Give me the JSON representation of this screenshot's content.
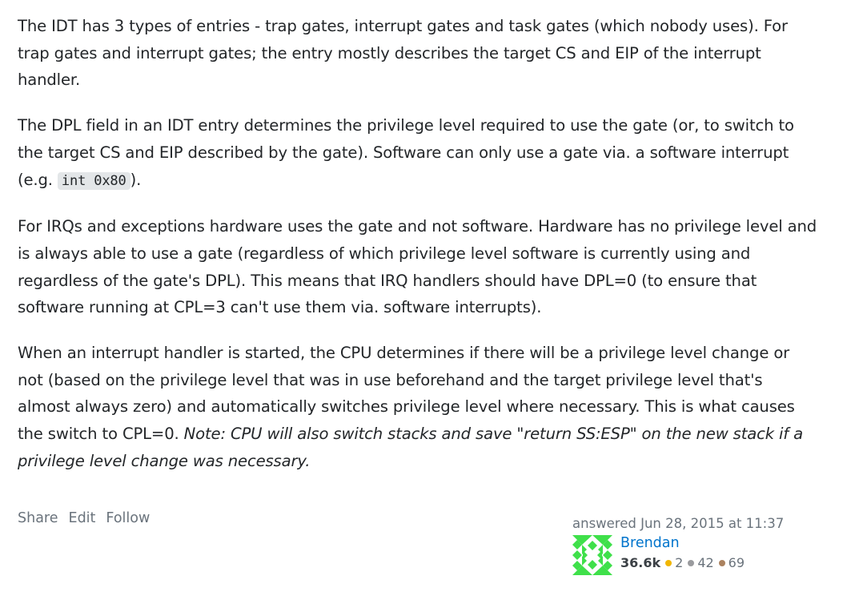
{
  "answer": {
    "p1": "The IDT has 3 types of entries - trap gates, interrupt gates and task gates (which nobody uses). For trap gates and interrupt gates; the entry mostly describes the target CS and EIP of the interrupt handler.",
    "p2_text": "The DPL field in an IDT entry determines the privilege level required to use the gate (or, to switch to the target CS and EIP described by the gate). Software can only use a gate via. a software interrupt (e.g. ",
    "p2_code": "int 0x80",
    "p2_end": ").",
    "p3": "For IRQs and exceptions hardware uses the gate and not software. Hardware has no privilege level and is always able to use a gate (regardless of which privilege level software is currently using and regardless of the gate's DPL). This means that IRQ handlers should have DPL=0 (to ensure that software running at CPL=3 can't use them via. software interrupts).",
    "p4_text": "When an interrupt handler is started, the CPU determines if there will be a privilege level change or not (based on the privilege level that was in use beforehand and the target privilege level that's almost always zero) and automatically switches privilege level where necessary. This is what causes the switch to CPL=0. ",
    "p4_italic": "Note: CPU will also switch stacks and save \"return SS:ESP\" on the new stack if a privilege level change was necessary."
  },
  "menu": {
    "share": "Share",
    "edit": "Edit",
    "follow": "Follow"
  },
  "signature": {
    "answered": "answered Jun 28, 2015 at 11:37",
    "user_name": "Brendan",
    "reputation": "36.6k",
    "gold_count": "2",
    "silver_count": "42",
    "bronze_count": "69"
  },
  "colors": {
    "link": "#0074cc",
    "muted": "#6a737c",
    "gold": "#f1b600",
    "silver": "#9a9b9e",
    "bronze": "#ab825f",
    "avatar": "#3fe04a",
    "code_bg": "#e3e6e8"
  },
  "icons": {
    "avatar": "identicon-avatar"
  }
}
